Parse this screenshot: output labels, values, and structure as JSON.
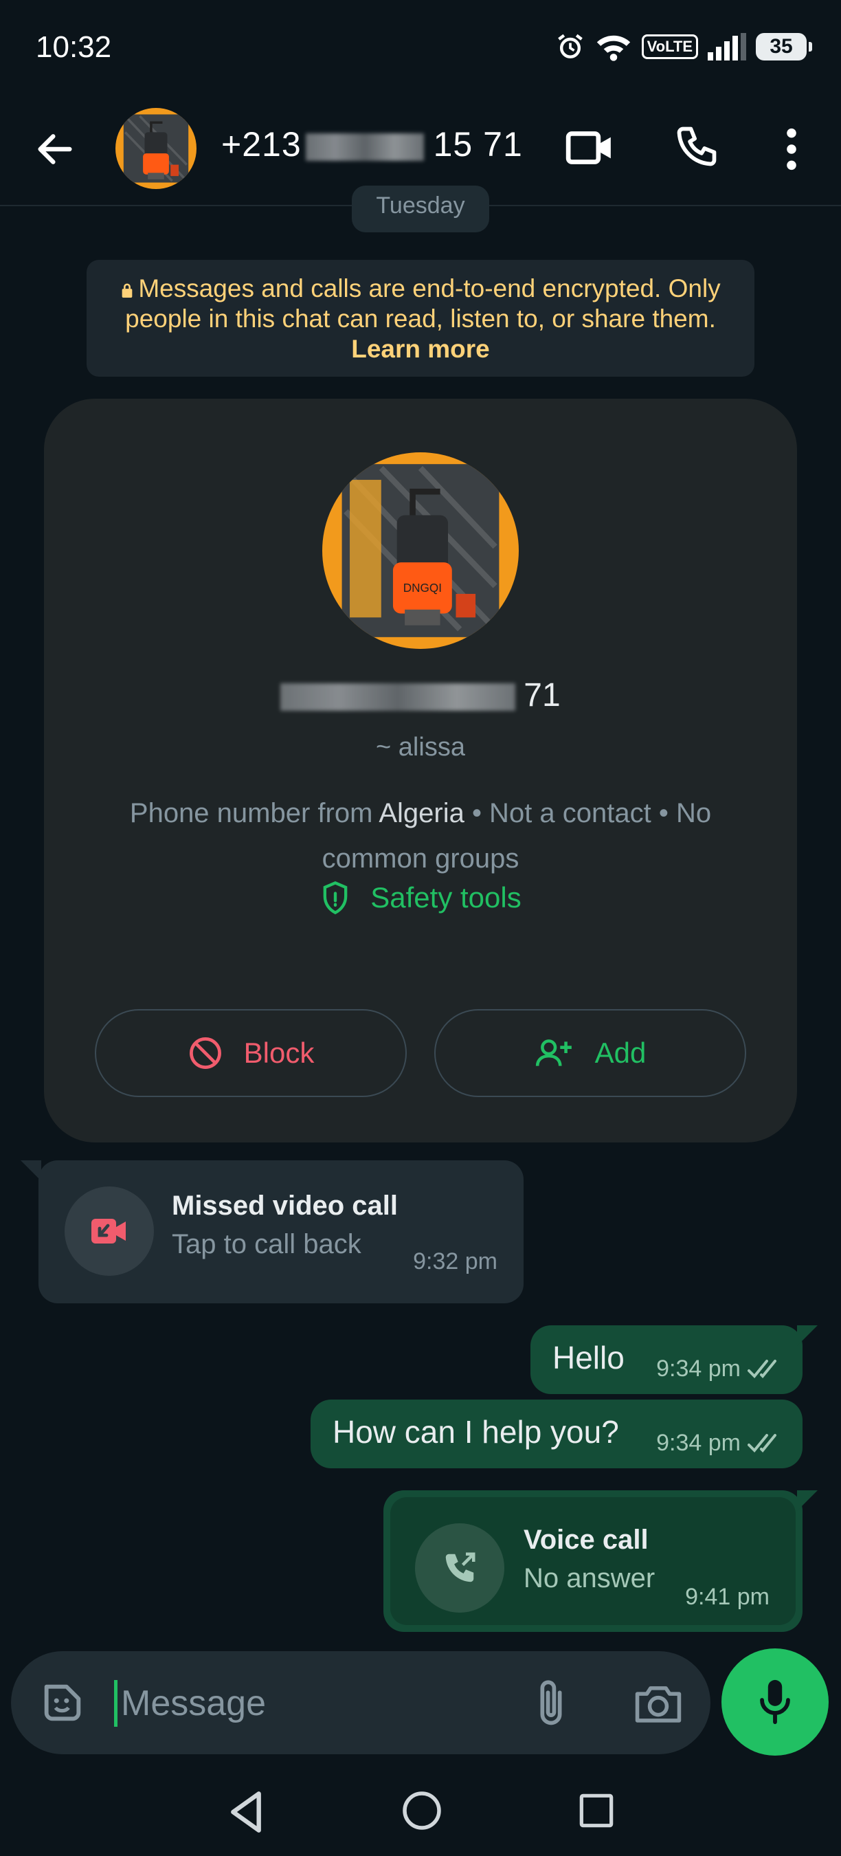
{
  "status_bar": {
    "time": "10:32",
    "network": "VoLTE",
    "battery": "35"
  },
  "header": {
    "title_prefix": "+213",
    "title_suffix": "15 71",
    "icons": [
      "back-arrow-icon",
      "video-call-icon",
      "phone-icon",
      "more-vert-icon"
    ]
  },
  "chat": {
    "date_chip": "Tuesday",
    "encryption_notice": {
      "text": "Messages and calls are end-to-end encrypted. Only people in this chat can read, listen to, or share them.",
      "link": "Learn more"
    },
    "contact_card": {
      "number_suffix": "71",
      "name": "~ alissa",
      "info_prefix": "Phone number from ",
      "country": "Algeria",
      "info_suffix": " • Not a contact • No common groups",
      "safety_tools": "Safety tools",
      "block_label": "Block",
      "add_label": "Add"
    },
    "messages": [
      {
        "type": "missed-video-call",
        "title": "Missed video call",
        "subtitle": "Tap to call back",
        "time": "9:32 pm"
      },
      {
        "type": "outgoing",
        "text": "Hello",
        "time": "9:34 pm"
      },
      {
        "type": "outgoing",
        "text": "How can I help you?",
        "time": "9:34 pm"
      },
      {
        "type": "voice-call",
        "title": "Voice call",
        "subtitle": "No answer",
        "time": "9:41 pm"
      }
    ]
  },
  "composer": {
    "placeholder": "Message"
  },
  "colors": {
    "accent": "#21c063",
    "outgoing_bubble": "#144d37",
    "danger": "#f15c6d",
    "notice": "#ffd279"
  }
}
